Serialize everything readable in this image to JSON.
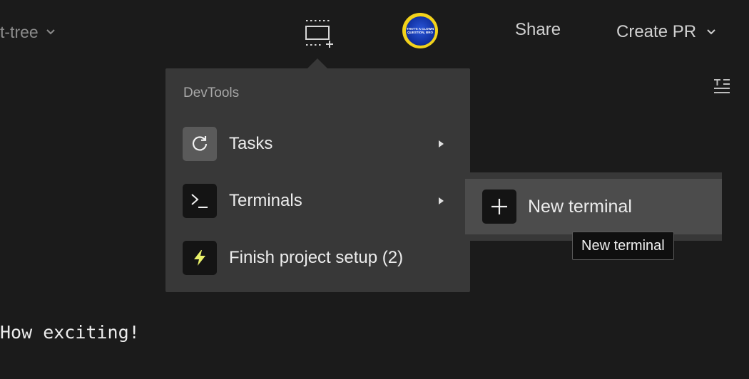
{
  "topbar": {
    "branch_label": "t-tree",
    "share_label": "Share",
    "create_pr_label": "Create PR",
    "avatar_text_line1": "THAT'S A CLOWN",
    "avatar_text_line2": "QUESTION, BRO"
  },
  "devtools_menu": {
    "header": "DevTools",
    "items": [
      {
        "label": "Tasks",
        "icon": "refresh-icon",
        "has_submenu": true
      },
      {
        "label": "Terminals",
        "icon": "terminal-icon",
        "has_submenu": true
      },
      {
        "label": "Finish project setup (2)",
        "icon": "lightning-icon",
        "has_submenu": false
      }
    ]
  },
  "terminals_submenu": {
    "items": [
      {
        "label": "New terminal",
        "icon": "plus-icon"
      }
    ]
  },
  "tooltip": {
    "text": "New terminal"
  },
  "editor": {
    "line": "How exciting!"
  },
  "colors": {
    "background": "#1b1b1b",
    "menu_bg": "#383838",
    "hover_bg": "#4c4c4c",
    "avatar_ring": "#f2d21b",
    "lightning": "#e8f06a"
  }
}
